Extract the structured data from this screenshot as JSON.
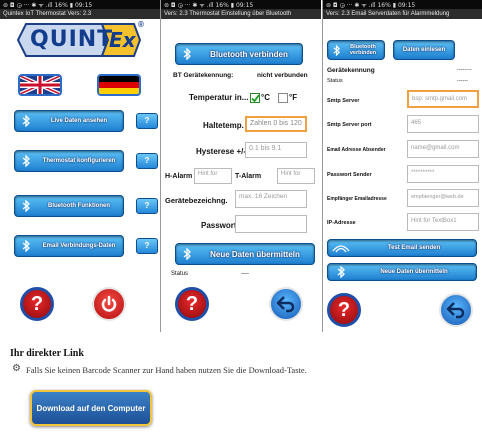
{
  "panel1": {
    "status": "⊚ ◘ ◶ ···          ✱ ᯤ .ıll 16% ▮ 09:15",
    "title": "Quintex IoT Thermostat Vers: 2.3",
    "logo": "QUINT",
    "logo_ex": "Ex",
    "logo_reg": "®",
    "buttons": [
      "Live Daten ansehen",
      "Thermostat konfigurieren",
      "Bluetooth Funktionen",
      "Email Verbindungs-Daten"
    ],
    "help": "?",
    "help_round": "?"
  },
  "panel2": {
    "status": "⊚ ◘ ◶ ···          ✱ ᯤ .ıll 16% ▮ 09:15",
    "title": "Vers: 2.3 Thermostat Einstellung über Bluetooth",
    "connect_btn": "Bluetooth verbinden",
    "bt_label": "BT Gerätekennung:",
    "bt_value": "nicht verbunden",
    "temp_label": "Temperatur in...",
    "celsius": "°C",
    "fahrenheit": "°F",
    "halte_label": "Haltetemp.",
    "halte_ph": "Zahlen 0 bis 120",
    "hyst_label": "Hysterese +/-",
    "hyst_ph": "0.1 bis 9.1",
    "h_alarm": "H-Alarm",
    "h_alarm_ph": "Hint for",
    "t_alarm": "T-Alarm",
    "t_alarm_ph": "Hint for",
    "geraet_label": "Gerätebezeichng.",
    "geraet_ph": "max. 16 Zeichen",
    "pass_label": "Passwort",
    "send_btn": "Neue Daten übermitteln",
    "status_label": "Status",
    "status_value": "----",
    "help_round": "?"
  },
  "panel3": {
    "status": "⊚ ◘ ◶ ···          ✱ ᯤ .ıll 16% ▮ 09:15",
    "title": "Vers: 2.3 Email Serverdaten für Alarmmeldung",
    "connect_btn": "Bluetooth verbinden",
    "load_btn": "Daten einlesen",
    "kennung_label": "Gerätekennung",
    "kennung_value": "--------",
    "status_label": "Status",
    "status_value": "------",
    "smtp_server": "Smtp Server",
    "smtp_server_ph": "bsp: smtp.gmail.com",
    "smtp_port": "Smtp Server port",
    "smtp_port_ph": "465",
    "email_abs": "Email Adresse Absender",
    "email_abs_ph": "name@gmail.com",
    "pass_sender": "Passwort Sender",
    "pass_sender_ph": "**********",
    "empf_label": "Empfänger Emailadresse",
    "empf_ph": "empfaenger@web.de",
    "ip_label": "IP-Adresse",
    "ip_ph": "Hint for TextBox1",
    "test_btn": "Test Email senden",
    "send_btn": "Neue Daten übermitteln",
    "help_round": "?"
  },
  "section": {
    "heading": "Ihr direkter Link",
    "text": "Falls Sie keinen Barcode Scanner zur Hand haben nutzen Sie die Download-Taste.",
    "download_btn": "Download auf den Computer"
  }
}
